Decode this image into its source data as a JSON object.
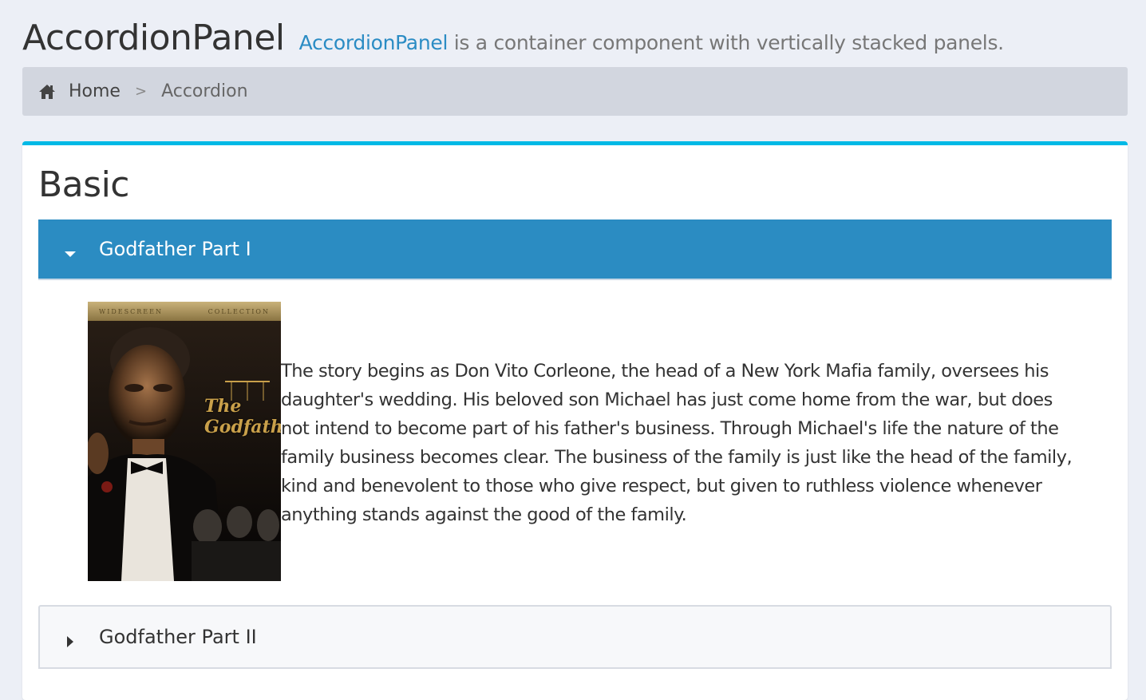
{
  "header": {
    "title": "AccordionPanel",
    "subtitle_link": "AccordionPanel",
    "subtitle_rest": " is a container component with vertically stacked panels."
  },
  "breadcrumb": {
    "home_icon": "home-icon",
    "home_label": "Home",
    "separator": ">",
    "current": "Accordion"
  },
  "card": {
    "title": "Basic",
    "accent_color": "#00b9e6"
  },
  "accordion": {
    "active_color": "#2b8cc2",
    "tabs": [
      {
        "title": "Godfather Part I",
        "expanded": true,
        "icon": "caret-down-icon",
        "poster": {
          "brand_left": "WIDESCREEN",
          "brand_right": "COLLECTION",
          "title": "The Godfather"
        },
        "content": "The story begins as Don Vito Corleone, the head of a New York Mafia family, oversees his daughter's wedding. His beloved son Michael has just come home from the war, but does not intend to become part of his father's business. Through Michael's life the nature of the family business becomes clear. The business of the family is just like the head of the family, kind and benevolent to those who give respect, but given to ruthless violence whenever anything stands against the good of the family."
      },
      {
        "title": "Godfather Part II",
        "expanded": false,
        "icon": "caret-right-icon"
      }
    ]
  }
}
